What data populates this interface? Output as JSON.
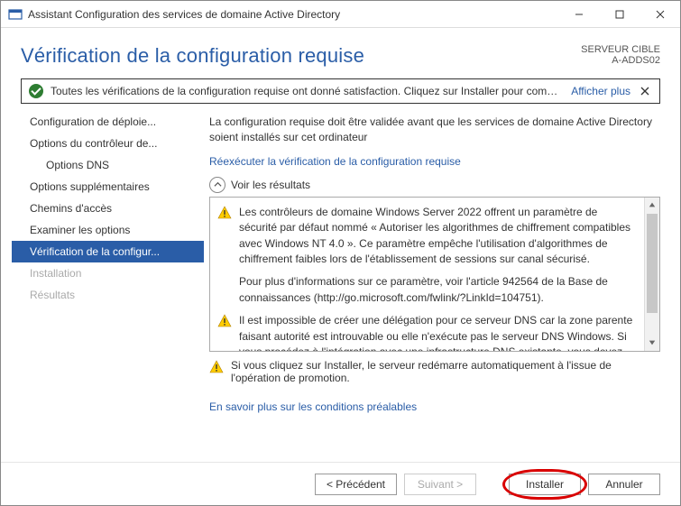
{
  "title": "Assistant Configuration des services de domaine Active Directory",
  "header": {
    "page_title": "Vérification de la configuration requise",
    "target_label": "SERVEUR CIBLE",
    "target_host": "A-ADDS02"
  },
  "status": {
    "message": "Toutes les vérifications de la configuration requise ont donné satisfaction. Cliquez sur Installer pour comme...",
    "show_more": "Afficher plus"
  },
  "sidebar": {
    "items": [
      {
        "label": "Configuration de déploie...",
        "indent": false,
        "active": false,
        "disabled": false
      },
      {
        "label": "Options du contrôleur de...",
        "indent": false,
        "active": false,
        "disabled": false
      },
      {
        "label": "Options DNS",
        "indent": true,
        "active": false,
        "disabled": false
      },
      {
        "label": "Options supplémentaires",
        "indent": false,
        "active": false,
        "disabled": false
      },
      {
        "label": "Chemins d'accès",
        "indent": false,
        "active": false,
        "disabled": false
      },
      {
        "label": "Examiner les options",
        "indent": false,
        "active": false,
        "disabled": false
      },
      {
        "label": "Vérification de la configur...",
        "indent": false,
        "active": true,
        "disabled": false
      },
      {
        "label": "Installation",
        "indent": false,
        "active": false,
        "disabled": true
      },
      {
        "label": "Résultats",
        "indent": false,
        "active": false,
        "disabled": true
      }
    ]
  },
  "content": {
    "intro": "La configuration requise doit être validée avant que les services de domaine Active Directory soient installés sur cet ordinateur",
    "rerun_link": "Réexécuter la vérification de la configuration requise",
    "results_header": "Voir les résultats",
    "warnings": [
      {
        "text": "Les contrôleurs de domaine Windows Server 2022 offrent un paramètre de sécurité par défaut nommé « Autoriser les algorithmes de chiffrement compatibles avec Windows NT 4.0 ». Ce paramètre empêche l'utilisation d'algorithmes de chiffrement faibles lors de l'établissement de sessions sur canal sécurisé.",
        "sub": "Pour plus d'informations sur ce paramètre, voir l'article 942564 de la Base de connaissances (http://go.microsoft.com/fwlink/?LinkId=104751)."
      },
      {
        "text": "Il est impossible de créer une délégation pour ce serveur DNS car la zone parente faisant autorité est introuvable ou elle n'exécute pas le serveur DNS Windows. Si vous procédez à l'intégration avec une infrastructure DNS existante, vous devez"
      }
    ],
    "bottom_warning": "Si vous cliquez sur Installer, le serveur redémarre automatiquement à l'issue de l'opération de promotion.",
    "learn_more": "En savoir plus sur les conditions préalables"
  },
  "buttons": {
    "prev": "< Précédent",
    "next": "Suivant >",
    "install": "Installer",
    "cancel": "Annuler"
  }
}
